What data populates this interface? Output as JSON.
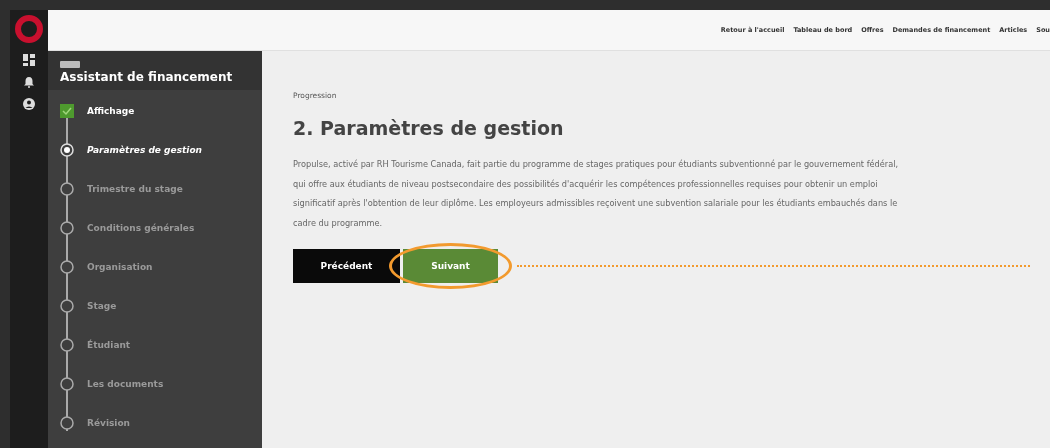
{
  "top_nav": {
    "links": [
      "Retour à l'accueil",
      "Tableau de bord",
      "Offres",
      "Demandes de financement",
      "Articles",
      "Sou"
    ]
  },
  "sidebar": {
    "title": "Assistant de financement",
    "steps": [
      {
        "label": "Affichage",
        "kind": "done"
      },
      {
        "label": "Paramètres de gestion",
        "kind": "current"
      },
      {
        "label": "Trimestre du stage",
        "kind": "pending"
      },
      {
        "label": "Conditions générales",
        "kind": "pending"
      },
      {
        "label": "Organisation",
        "kind": "pending"
      },
      {
        "label": "Stage",
        "kind": "pending"
      },
      {
        "label": "Étudiant",
        "kind": "pending"
      },
      {
        "label": "Les documents",
        "kind": "pending"
      },
      {
        "label": "Révision",
        "kind": "pending"
      }
    ]
  },
  "main": {
    "breadcrumb": "Progression",
    "title": "2. Paramètres de gestion",
    "paragraph": "Propulse, activé par RH Tourisme Canada, fait partie du programme de stages pratiques pour étudiants subventionné par le gouvernement fédéral, qui offre aux étudiants de niveau postsecondaire des possibilités d'acquérir les compétences professionnelles requises pour obtenir un emploi significatif après l'obtention de leur diplôme. Les employeurs admissibles reçoivent une subvention salariale pour les étudiants embauchés dans le cadre du programme.",
    "buttons": [
      {
        "label": "Précédent",
        "kind": "secondary"
      },
      {
        "label": "Suivant",
        "kind": "primary",
        "highlighted": true
      }
    ]
  }
}
